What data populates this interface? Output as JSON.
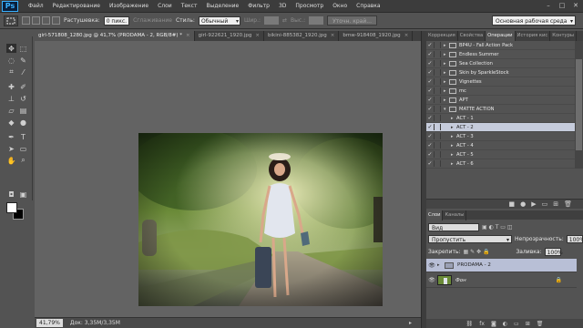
{
  "app": {
    "logo": "Ps"
  },
  "menu": [
    "Файл",
    "Редактирование",
    "Изображение",
    "Слои",
    "Текст",
    "Выделение",
    "Фильтр",
    "3D",
    "Просмотр",
    "Окно",
    "Справка"
  ],
  "options": {
    "feather_label": "Растушевка:",
    "feather_value": "0 пикс.",
    "antialias_label": "Сглаживание",
    "style_label": "Стиль:",
    "style_value": "Обычный",
    "width_label": "Шир.:",
    "height_label": "Выс.:",
    "refine_label": "Уточн. край...",
    "workspace": "Основная рабочая среда"
  },
  "tabs": [
    {
      "label": "girl-571808_1280.jpg @ 41,7% (PRODAMA - 2, RGB/8#) *",
      "active": true
    },
    {
      "label": "girl-922621_1920.jpg",
      "active": false
    },
    {
      "label": "bikini-885382_1920.jpg",
      "active": false
    },
    {
      "label": "bmw-918408_1920.jpg",
      "active": false
    }
  ],
  "status": {
    "zoom": "41,79%",
    "doc": "Док: 3,35М/3,35М"
  },
  "panel_tabs": [
    "Коррекция",
    "Свойства",
    "Операции",
    "История кис",
    "Контуры"
  ],
  "actions": [
    {
      "label": "BP4U - Fall Action Pack",
      "type": "folder",
      "selected": false
    },
    {
      "label": "Endless Summer",
      "type": "folder",
      "selected": false
    },
    {
      "label": "Sea Collection",
      "type": "folder",
      "selected": false
    },
    {
      "label": "Skin by SparkleStock",
      "type": "folder",
      "selected": false
    },
    {
      "label": "Vignettes",
      "type": "folder",
      "selected": false
    },
    {
      "label": "mc",
      "type": "folder",
      "selected": false
    },
    {
      "label": "APT",
      "type": "folder",
      "selected": false
    },
    {
      "label": "MATTE ACTION",
      "type": "folder-open",
      "selected": false
    },
    {
      "label": "ACT - 1",
      "type": "action",
      "selected": false
    },
    {
      "label": "ACT - 2",
      "type": "action",
      "selected": true
    },
    {
      "label": "ACT - 3",
      "type": "action",
      "selected": false
    },
    {
      "label": "ACT - 4",
      "type": "action",
      "selected": false
    },
    {
      "label": "ACT - 5",
      "type": "action",
      "selected": false
    },
    {
      "label": "ACT - 6",
      "type": "action",
      "selected": false
    }
  ],
  "layers_panel": {
    "tabs": [
      "Слои",
      "Каналы"
    ],
    "filter": "Вид",
    "blend_mode": "Пропустить",
    "opacity_label": "Непрозрачность:",
    "opacity_value": "100%",
    "lock_label": "Закрепить:",
    "fill_label": "Заливка:",
    "fill_value": "100%",
    "layers": [
      {
        "name": "PRODAMA - 2",
        "type": "group",
        "selected": true
      },
      {
        "name": "Фон",
        "type": "image",
        "selected": false
      }
    ]
  }
}
